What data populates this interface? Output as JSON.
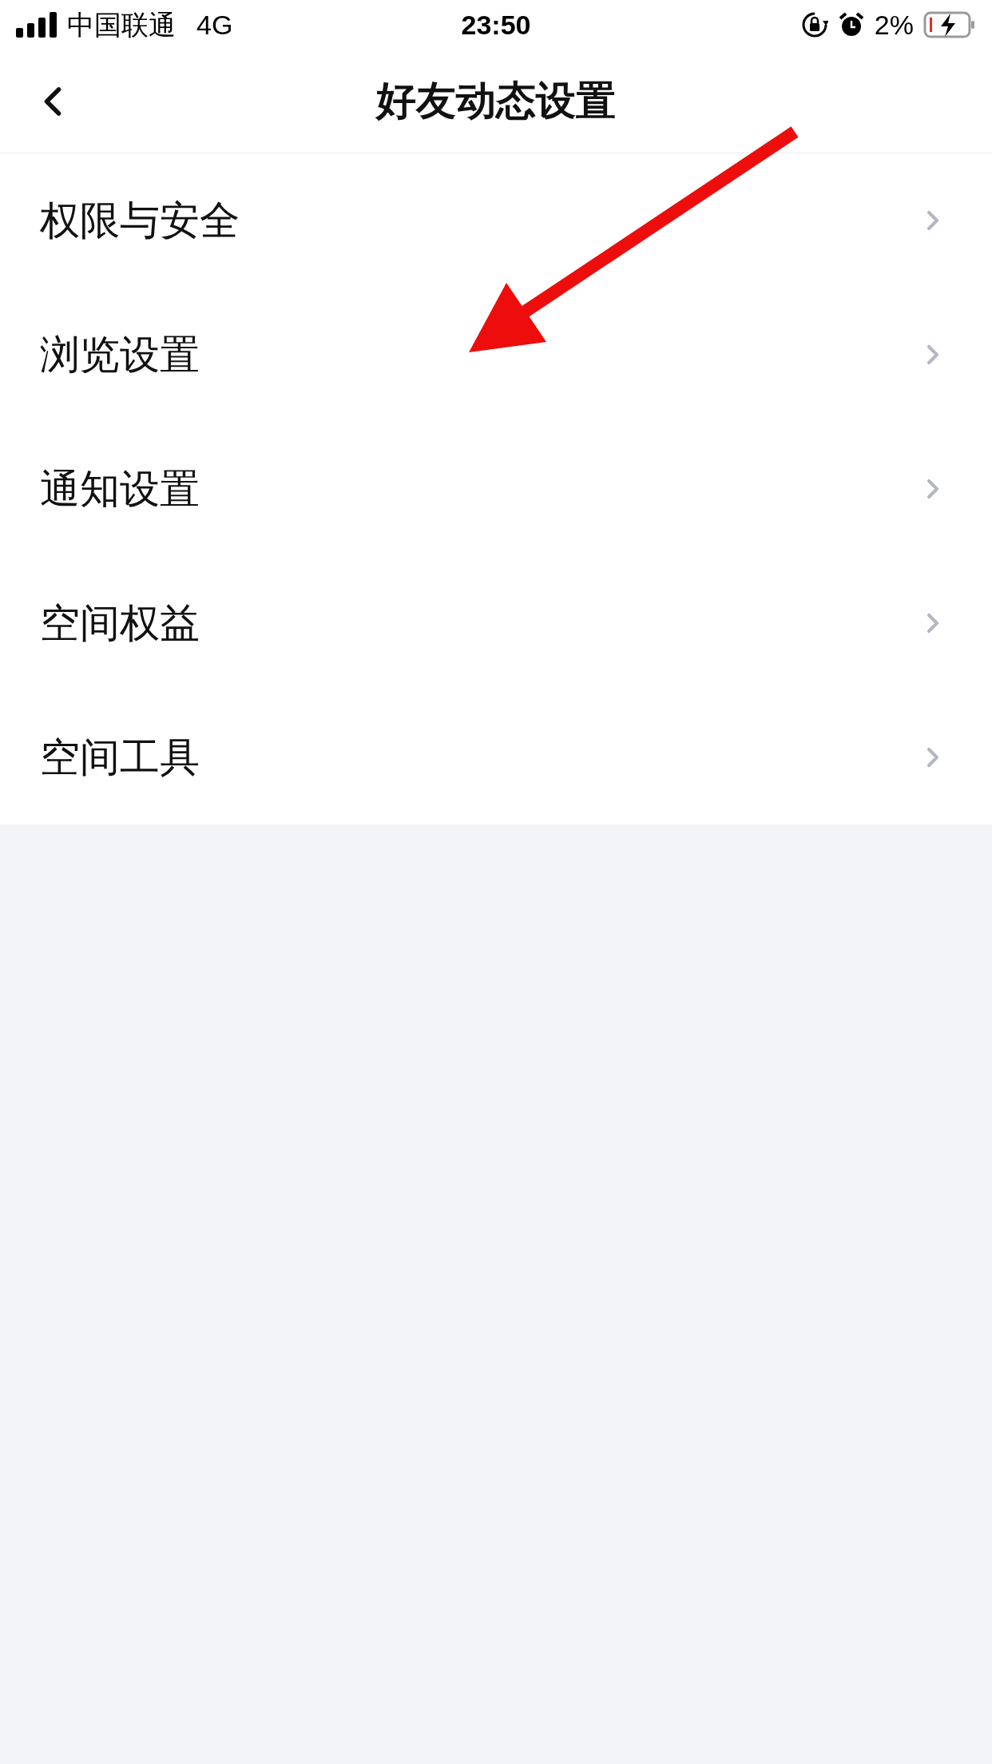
{
  "status_bar": {
    "carrier": "中国联通",
    "network": "4G",
    "time": "23:50",
    "battery": "2%"
  },
  "nav_bar": {
    "title": "好友动态设置"
  },
  "menu": [
    {
      "label": "权限与安全"
    },
    {
      "label": "浏览设置"
    },
    {
      "label": "通知设置"
    },
    {
      "label": "空间权益"
    },
    {
      "label": "空间工具"
    }
  ]
}
